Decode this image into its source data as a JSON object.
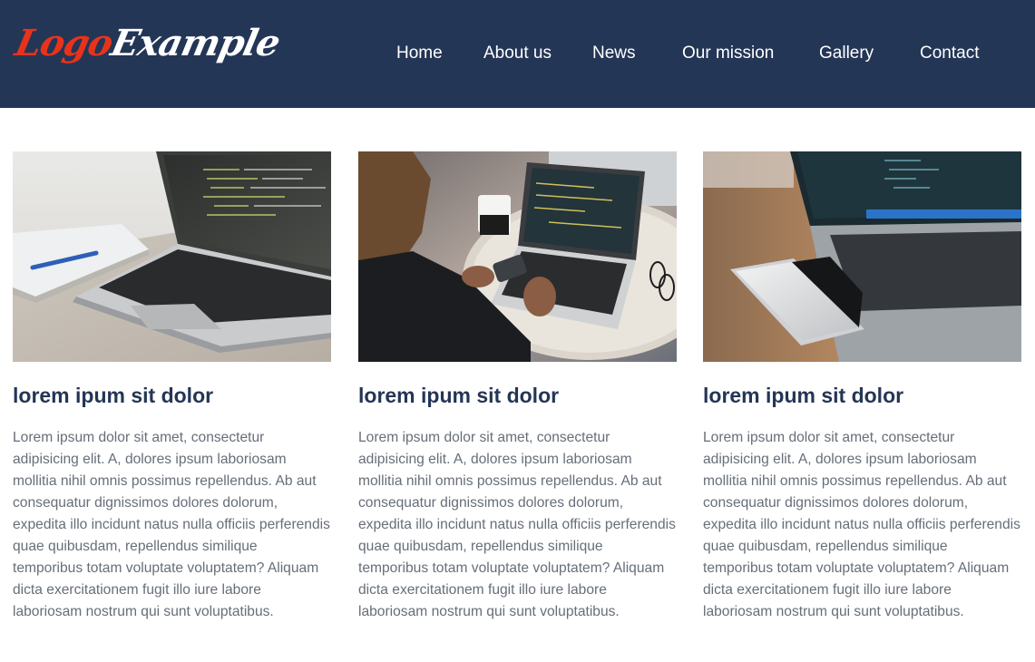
{
  "header": {
    "logo": {
      "part_1": "Logo",
      "part_2": "Example"
    },
    "nav": [
      {
        "label": "Home"
      },
      {
        "label": "About us"
      },
      {
        "label": "News"
      },
      {
        "label": "Our mission"
      },
      {
        "label": "Gallery"
      },
      {
        "label": "Contact"
      }
    ]
  },
  "cards": [
    {
      "title": "lorem ipum sit dolor",
      "text": "Lorem ipsum dolor sit amet, consectetur adipisicing elit. A, dolores ipsum laboriosam mollitia nihil omnis possimus repellendus. Ab aut consequatur dignissimos dolores dolorum, expedita illo incidunt natus nulla officiis perferendis quae quibusdam, repellendus similique temporibus totam voluptate voluptatem? Aliquam dicta exercitationem fugit illo iure labore laboriosam nostrum qui sunt voluptatibus."
    },
    {
      "title": "lorem ipum sit dolor",
      "text": "Lorem ipsum dolor sit amet, consectetur adipisicing elit. A, dolores ipsum laboriosam mollitia nihil omnis possimus repellendus. Ab aut consequatur dignissimos dolores dolorum, expedita illo incidunt natus nulla officiis perferendis quae quibusdam, repellendus similique temporibus totam voluptate voluptatem? Aliquam dicta exercitationem fugit illo iure labore laboriosam nostrum qui sunt voluptatibus."
    },
    {
      "title": "lorem ipum sit dolor",
      "text": "Lorem ipsum dolor sit amet, consectetur adipisicing elit. A, dolores ipsum laboriosam mollitia nihil omnis possimus repellendus. Ab aut consequatur dignissimos dolores dolorum, expedita illo incidunt natus nulla officiis perferendis quae quibusdam, repellendus similique temporibus totam voluptate voluptatem? Aliquam dicta exercitationem fugit illo iure labore laboriosam nostrum qui sunt voluptatibus."
    }
  ],
  "colors": {
    "header_bg": "#243656",
    "logo_accent": "#e8331c",
    "title": "#243656",
    "body_text": "#666e78"
  }
}
